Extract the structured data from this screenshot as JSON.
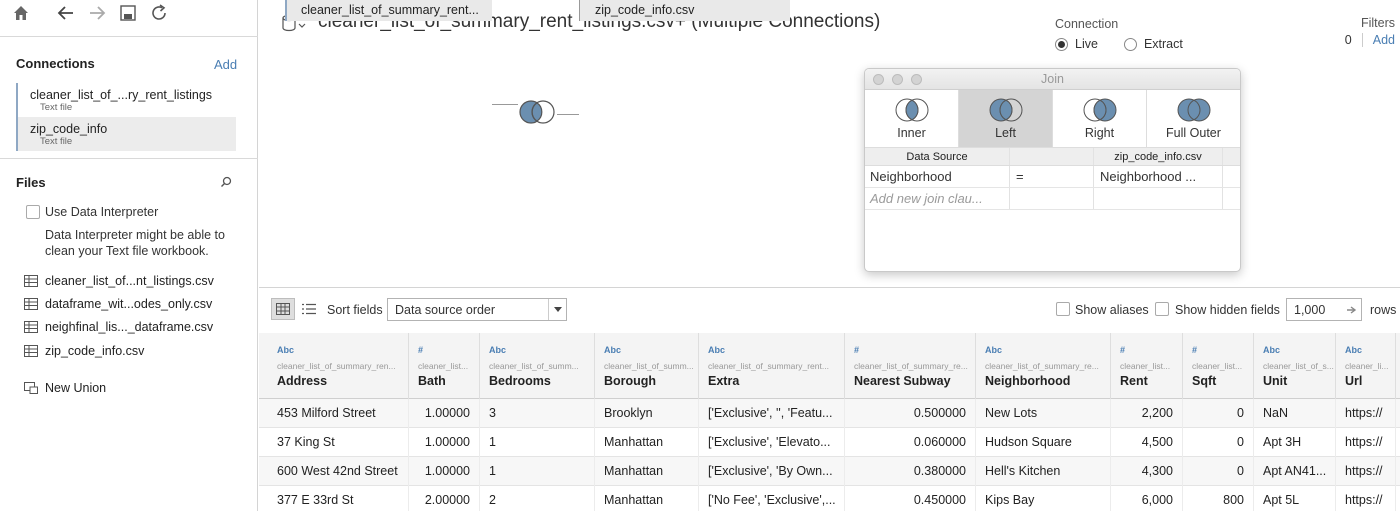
{
  "toolbar": {
    "icons": [
      "home-icon",
      "back-icon",
      "forward-icon",
      "save-icon",
      "refresh-icon"
    ]
  },
  "sidebar": {
    "connections_title": "Connections",
    "add_label": "Add",
    "connections": [
      {
        "name": "cleaner_list_of_...ry_rent_listings",
        "type": "Text file"
      },
      {
        "name": "zip_code_info",
        "type": "Text file"
      }
    ],
    "files_title": "Files",
    "use_interpreter_label": "Use Data Interpreter",
    "interpreter_hint": "Data Interpreter might be able to clean your Text file workbook.",
    "files": [
      "cleaner_list_of...nt_listings.csv",
      "dataframe_wit...odes_only.csv",
      "neighfinal_lis..._dataframe.csv",
      "zip_code_info.csv"
    ],
    "new_union_label": "New Union"
  },
  "canvas": {
    "title": "cleaner_list_of_summary_rent_listings.csv+ (Multiple Connections)",
    "connection_label": "Connection",
    "live_label": "Live",
    "extract_label": "Extract",
    "connection_mode": "Live",
    "filters_label": "Filters",
    "filters_count": "0",
    "filters_add": "Add",
    "left_table": "cleaner_list_of_summary_rent...",
    "right_table": "zip_code_info.csv"
  },
  "join_dialog": {
    "title": "Join",
    "types": [
      "Inner",
      "Left",
      "Right",
      "Full Outer"
    ],
    "selected_type": "Left",
    "header_left": "Data Source",
    "header_right": "zip_code_info.csv",
    "clause_left": "Neighborhood",
    "clause_op": "=",
    "clause_right": "Neighborhood ...",
    "new_clause_placeholder": "Add new join clau..."
  },
  "grid_toolbar": {
    "sort_label": "Sort fields",
    "sort_value": "Data source order",
    "show_aliases": "Show aliases",
    "show_hidden": "Show hidden fields",
    "rows_value": "1,000",
    "rows_label": "rows"
  },
  "grid": {
    "columns": [
      {
        "type": "Abc",
        "source": "cleaner_list_of_summary_ren...",
        "name": "Address"
      },
      {
        "type": "#",
        "source": "cleaner_list...",
        "name": "Bath"
      },
      {
        "type": "Abc",
        "source": "cleaner_list_of_summ...",
        "name": "Bedrooms"
      },
      {
        "type": "Abc",
        "source": "cleaner_list_of_summ...",
        "name": "Borough"
      },
      {
        "type": "Abc",
        "source": "cleaner_list_of_summary_rent...",
        "name": "Extra"
      },
      {
        "type": "#",
        "source": "cleaner_list_of_summary_re...",
        "name": "Nearest Subway"
      },
      {
        "type": "Abc",
        "source": "cleaner_list_of_summary_re...",
        "name": "Neighborhood"
      },
      {
        "type": "#",
        "source": "cleaner_list...",
        "name": "Rent"
      },
      {
        "type": "#",
        "source": "cleaner_list...",
        "name": "Sqft"
      },
      {
        "type": "Abc",
        "source": "cleaner_list_of_s...",
        "name": "Unit"
      },
      {
        "type": "Abc",
        "source": "cleaner_li...",
        "name": "Url"
      }
    ],
    "rows": [
      [
        "453 Milford Street",
        "1.00000",
        "3",
        "Brooklyn",
        "['Exclusive', '', 'Featu...",
        "0.500000",
        "New Lots",
        "2,200",
        "0",
        "NaN",
        "https://"
      ],
      [
        "37 King St",
        "1.00000",
        "1",
        "Manhattan",
        "['Exclusive', 'Elevato...",
        "0.060000",
        "Hudson Square",
        "4,500",
        "0",
        "Apt 3H",
        "https://"
      ],
      [
        "600 West 42nd Street",
        "1.00000",
        "1",
        "Manhattan",
        "['Exclusive', 'By Own...",
        "0.380000",
        "Hell's Kitchen",
        "4,300",
        "0",
        "Apt AN41...",
        "https://"
      ],
      [
        "377 E 33rd St",
        "2.00000",
        "2",
        "Manhattan",
        "['No Fee', 'Exclusive',...",
        "0.450000",
        "Kips Bay",
        "6,000",
        "800",
        "Apt 5L",
        "https://"
      ]
    ]
  }
}
